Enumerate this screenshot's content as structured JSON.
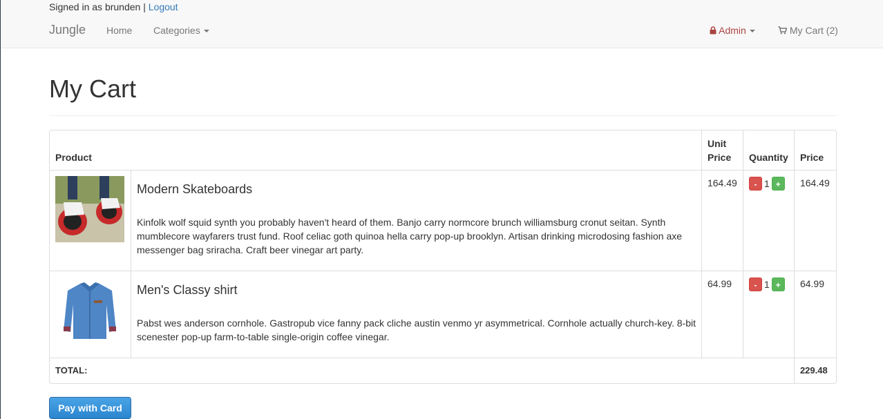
{
  "header": {
    "signed_in_text": "Signed in as brunden",
    "separator": "|",
    "logout_label": "Logout",
    "brand": "Jungle",
    "nav": {
      "home": "Home",
      "categories": "Categories"
    },
    "admin_label": "Admin",
    "cart_label": "My Cart (2)"
  },
  "page": {
    "title": "My Cart"
  },
  "table": {
    "headers": {
      "product": "Product",
      "unit_price_line1": "Unit",
      "unit_price_line2": "Price",
      "quantity": "Quantity",
      "price": "Price"
    },
    "items": [
      {
        "name": "Modern Skateboards",
        "description": "Kinfolk wolf squid synth you probably haven't heard of them. Banjo carry normcore brunch williamsburg cronut seitan. Synth mumblecore wayfarers trust fund. Roof celiac goth quinoa hella carry pop-up brooklyn. Artisan drinking microdosing fashion axe messenger bag sriracha. Craft beer vinegar art party.",
        "unit_price": "164.49",
        "quantity": "1",
        "price": "164.49",
        "image_icon": "skateboard-image"
      },
      {
        "name": "Men's Classy shirt",
        "description": "Pabst wes anderson cornhole. Gastropub vice fanny pack cliche austin venmo yr asymmetrical. Cornhole actually church-key. 8-bit scenester pop-up farm-to-table single-origin coffee vinegar.",
        "unit_price": "64.99",
        "quantity": "1",
        "price": "64.99",
        "image_icon": "shirt-image"
      }
    ],
    "minus_label": "-",
    "plus_label": "+",
    "total_label": "TOTAL:",
    "total_value": "229.48"
  },
  "actions": {
    "pay_label": "Pay with Card"
  },
  "colors": {
    "link": "#337ab7",
    "admin": "#a94442",
    "minus_button": "#d9534f",
    "plus_button": "#5cb85c",
    "pay_button": "#2a86cf",
    "navbar_bg": "#f8f8f8"
  }
}
